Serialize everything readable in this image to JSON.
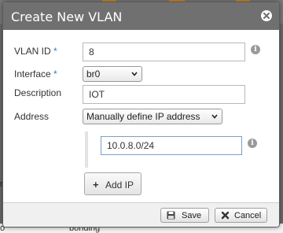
{
  "background": {
    "partial_left_text": "r",
    "bottom_left_text": "o",
    "bottom_text": "bonding"
  },
  "dialog": {
    "title": "Create New VLAN",
    "fields": {
      "vlan_id": {
        "label": "VLAN ID",
        "required_mark": "*",
        "value": "8"
      },
      "interface": {
        "label": "Interface",
        "required_mark": "*",
        "selected": "br0"
      },
      "description": {
        "label": "Description",
        "value": "IOT"
      },
      "address": {
        "label": "Address",
        "selected": "Manually define IP address"
      },
      "ip": {
        "value": "10.0.8.0/24"
      }
    },
    "add_ip_label": "Add IP",
    "footer": {
      "save_label": "Save",
      "cancel_label": "Cancel"
    }
  },
  "icons": {
    "close": "close-icon",
    "info": "info-icon",
    "chevron": "chevron-down-icon",
    "plus": "plus-icon",
    "save": "floppy-disk-icon",
    "cancel": "x-icon"
  },
  "colors": {
    "header": "#707070",
    "required": "#3a78c2",
    "focus_border": "#7aa0c8"
  }
}
